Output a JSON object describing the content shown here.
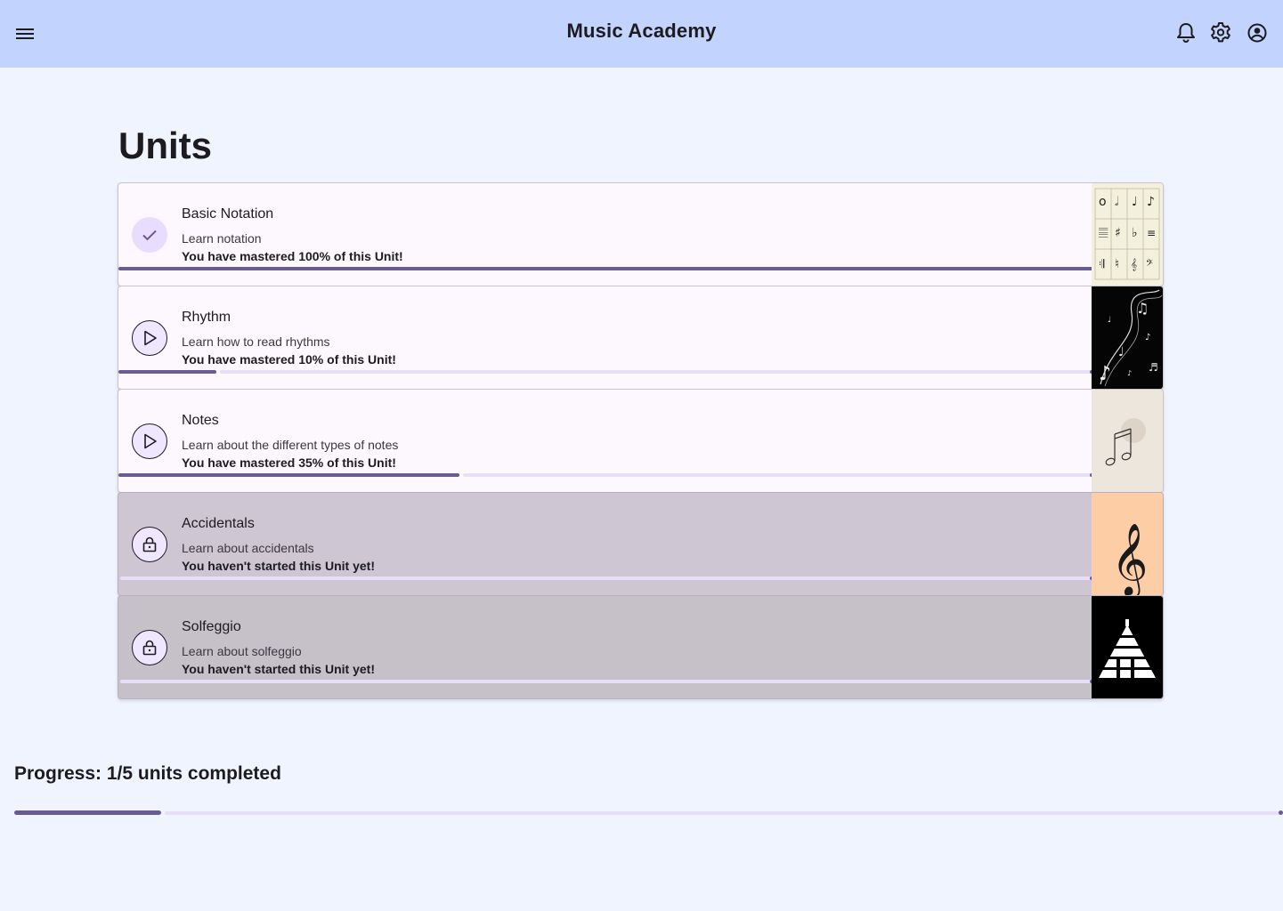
{
  "app": {
    "title": "Music Academy"
  },
  "header": {
    "menu_icon": "menu-icon",
    "notifications_icon": "bell-icon",
    "settings_icon": "gear-icon",
    "account_icon": "account-circle-icon"
  },
  "page": {
    "title": "Units"
  },
  "units": [
    {
      "name": "Basic Notation",
      "description": "Learn notation",
      "mastery": "You have mastered 100% of this Unit!",
      "progress": 1.0,
      "status": "completed",
      "status_icon": "check-icon",
      "thumbnail": "notation-chart-image"
    },
    {
      "name": "Rhythm",
      "description": "Learn how to read rhythms",
      "mastery": "You have mastered 10% of this Unit!",
      "progress": 0.1,
      "status": "in-progress",
      "status_icon": "play-icon",
      "thumbnail": "music-notes-swirl-image"
    },
    {
      "name": "Notes",
      "description": "Learn about the different types of notes",
      "mastery": "You have mastered 35% of this Unit!",
      "progress": 0.35,
      "status": "in-progress",
      "status_icon": "play-icon",
      "thumbnail": "beamed-notes-image"
    },
    {
      "name": "Accidentals",
      "description": "Learn about accidentals",
      "mastery": "You haven't started this Unit yet!",
      "progress": 0,
      "status": "locked",
      "status_icon": "lock-icon",
      "thumbnail": "treble-clef-image"
    },
    {
      "name": "Solfeggio",
      "description": "Learn about solfeggio",
      "mastery": "You haven't started this Unit yet!",
      "progress": 0,
      "status": "locked",
      "status_icon": "lock-icon",
      "thumbnail": "piano-pyramid-image"
    }
  ],
  "overall": {
    "label": "Progress: 1/5 units completed",
    "completed": 1,
    "total": 5,
    "progress": 0.2
  },
  "colors": {
    "header": "#c2d3fd",
    "background": "#f0f4ff",
    "accent": "#6b5b95",
    "track": "#e7dff8",
    "card": "#fdf7fe",
    "locked_card": "#cec6d2"
  }
}
